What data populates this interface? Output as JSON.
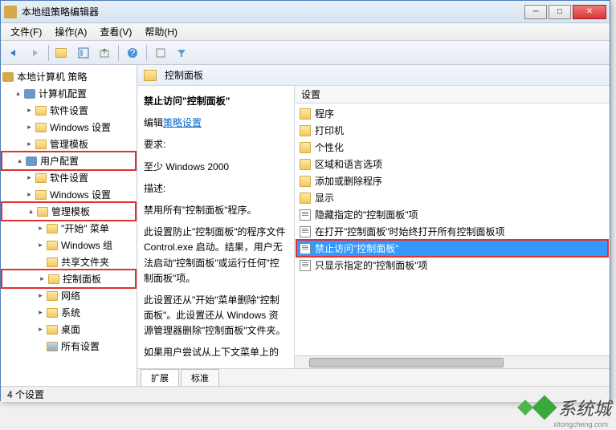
{
  "window": {
    "title": "本地组策略编辑器"
  },
  "menus": {
    "file": "文件(F)",
    "action": "操作(A)",
    "view": "查看(V)",
    "help": "帮助(H)"
  },
  "tree": {
    "root": "本地计算机 策略",
    "computer_config": "计算机配置",
    "software_settings": "软件设置",
    "windows_settings": "Windows 设置",
    "admin_templates": "管理模板",
    "user_config": "用户配置",
    "start_menu": "\"开始\" 菜单",
    "windows_group": "Windows 组",
    "shared_folders": "共享文件夹",
    "control_panel": "控制面板",
    "network": "网络",
    "system": "系统",
    "desktop": "桌面",
    "all_settings": "所有设置"
  },
  "path": {
    "label": "控制面板"
  },
  "desc": {
    "title": "禁止访问\"控制面板\"",
    "edit_label": "编辑",
    "edit_link": "策略设置",
    "req_label": "要求:",
    "req_text": "至少 Windows 2000",
    "desc_label": "描述:",
    "desc_text1": "禁用所有\"控制面板\"程序。",
    "desc_text2": "此设置防止\"控制面板\"的程序文件 Control.exe 启动。结果，用户无法启动\"控制面板\"或运行任何\"控制面板\"项。",
    "desc_text3": "此设置还从\"开始\"菜单删除\"控制面板\"。此设置还从 Windows 资源管理器删除\"控制面板\"文件夹。",
    "desc_text4": "如果用户尝试从上下文菜单上的"
  },
  "settings": {
    "header": "设置",
    "items": [
      {
        "type": "folder",
        "label": "程序"
      },
      {
        "type": "folder",
        "label": "打印机"
      },
      {
        "type": "folder",
        "label": "个性化"
      },
      {
        "type": "folder",
        "label": "区域和语言选项"
      },
      {
        "type": "folder",
        "label": "添加或删除程序"
      },
      {
        "type": "folder",
        "label": "显示"
      },
      {
        "type": "doc",
        "label": "隐藏指定的\"控制面板\"项"
      },
      {
        "type": "doc",
        "label": "在打开\"控制面板\"时始终打开所有控制面板项"
      },
      {
        "type": "doc",
        "label": "禁止访问\"控制面板\"",
        "selected": true
      },
      {
        "type": "doc",
        "label": "只显示指定的\"控制面板\"项"
      }
    ]
  },
  "tabs": {
    "extended": "扩展",
    "standard": "标准"
  },
  "status": "4 个设置",
  "watermark": {
    "text": "系统城",
    "url": "xitongcheng.com"
  }
}
